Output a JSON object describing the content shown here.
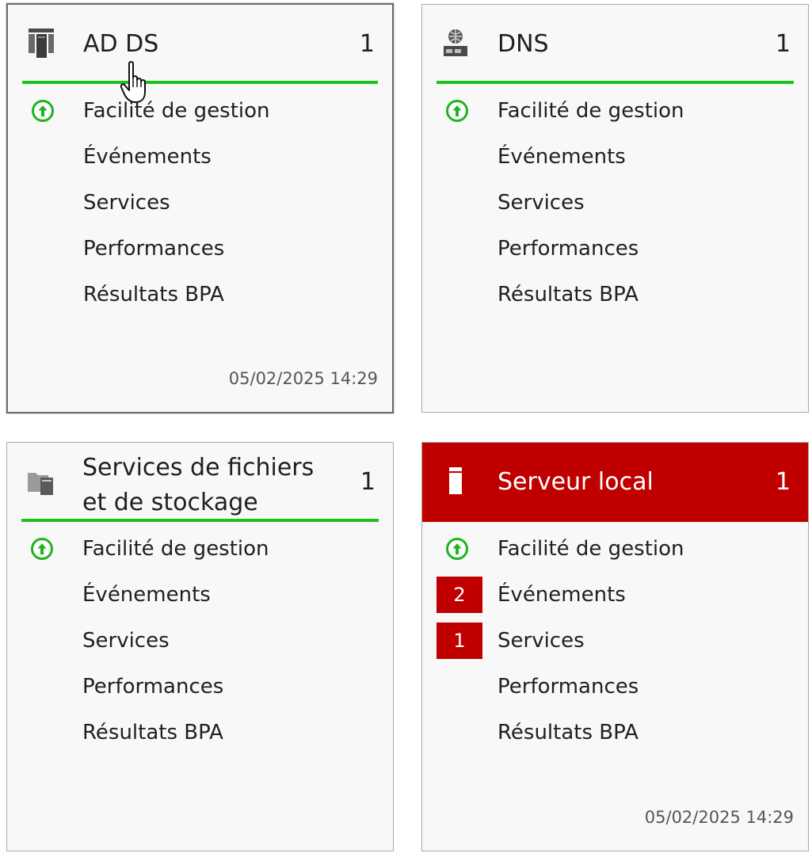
{
  "colors": {
    "healthy_green": "#1fc11f",
    "alert_red": "#c00000"
  },
  "tiles": [
    {
      "title": "AD DS",
      "count": "1",
      "icon": "ad-ds-role-icon",
      "status": "healthy",
      "rows": [
        "Facilité de gestion",
        "Événements",
        "Services",
        "Performances",
        "Résultats BPA"
      ],
      "timestamp": "05/02/2025 14:29"
    },
    {
      "title": "DNS",
      "count": "1",
      "icon": "dns-role-icon",
      "status": "healthy",
      "rows": [
        "Facilité de gestion",
        "Événements",
        "Services",
        "Performances",
        "Résultats BPA"
      ]
    },
    {
      "title": "Services de fichiers et de stockage",
      "count": "1",
      "icon": "file-storage-role-icon",
      "status": "healthy",
      "rows": [
        "Facilité de gestion",
        "Événements",
        "Services",
        "Performances",
        "Résultats BPA"
      ]
    },
    {
      "title": "Serveur local",
      "count": "1",
      "icon": "local-server-icon",
      "status": "alert",
      "rows": [
        "Facilité de gestion",
        "Événements",
        "Services",
        "Performances",
        "Résultats BPA"
      ],
      "badges": {
        "events": "2",
        "services": "1"
      },
      "timestamp": "05/02/2025 14:29"
    }
  ]
}
